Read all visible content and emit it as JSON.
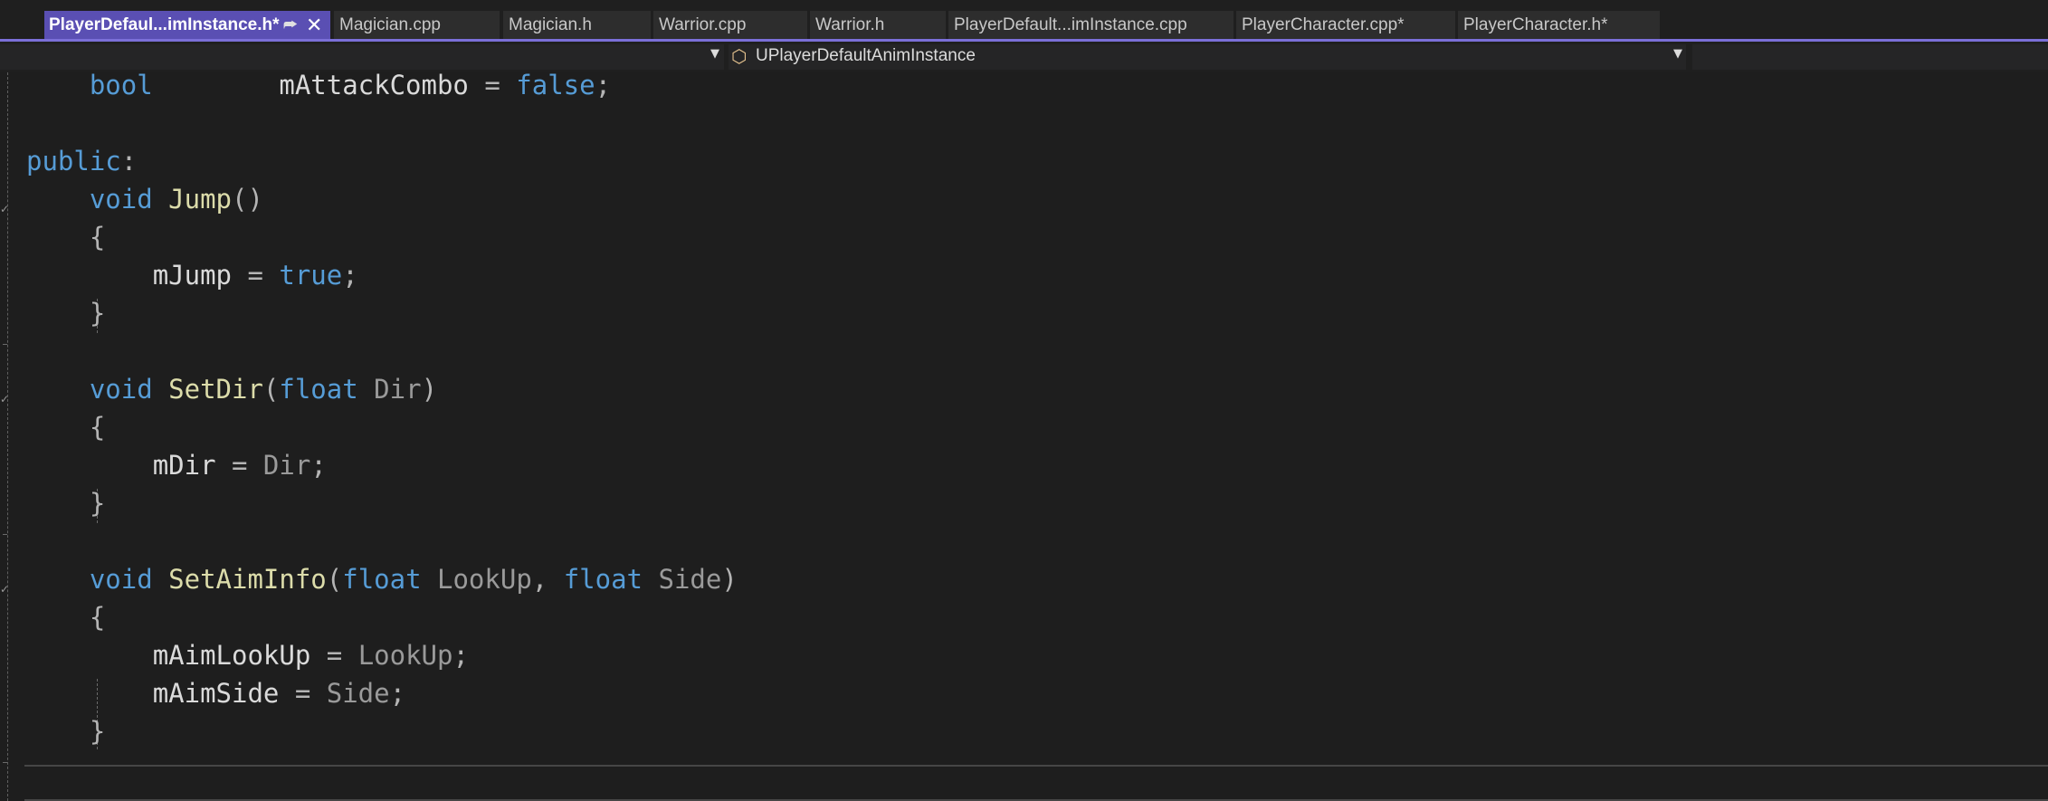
{
  "tabs": [
    {
      "label": "PlayerDefaul...imInstance.h*",
      "active": true,
      "pin_icon": "pin-icon",
      "close_icon": "close-icon"
    },
    {
      "label": "Magician.cpp"
    },
    {
      "label": "Magician.h"
    },
    {
      "label": "Warrior.cpp"
    },
    {
      "label": "Warrior.h"
    },
    {
      "label": "PlayerDefault...imInstance.cpp"
    },
    {
      "label": "PlayerCharacter.cpp*"
    },
    {
      "label": "PlayerCharacter.h*"
    }
  ],
  "navbar": {
    "scope_selector": "",
    "class_selector": "UPlayerDefaultAnimInstance",
    "class_icon": "class-icon",
    "member_selector": ""
  },
  "colors": {
    "active_tab": "#5a4fb3",
    "keyword": "#569cd6",
    "function": "#dcdcaa",
    "parameter": "#9a9a9a",
    "identifier": "#dadada",
    "background": "#1e1e1e"
  },
  "code": {
    "lines": [
      [
        {
          "t": "    "
        },
        {
          "t": "bool",
          "c": "kw"
        },
        {
          "t": "        "
        },
        {
          "t": "mAttackCombo",
          "c": "var"
        },
        {
          "t": " = ",
          "c": "pun"
        },
        {
          "t": "false",
          "c": "kw"
        },
        {
          "t": ";",
          "c": "pun"
        }
      ],
      [],
      [
        {
          "t": "public",
          "c": "kw"
        },
        {
          "t": ":",
          "c": "pun"
        }
      ],
      [
        {
          "t": "    "
        },
        {
          "t": "void",
          "c": "kw"
        },
        {
          "t": " "
        },
        {
          "t": "Jump",
          "c": "fn"
        },
        {
          "t": "()",
          "c": "pun"
        }
      ],
      [
        {
          "t": "    "
        },
        {
          "t": "{",
          "c": "pun"
        }
      ],
      [
        {
          "t": "        "
        },
        {
          "t": "mJump",
          "c": "var"
        },
        {
          "t": " = ",
          "c": "pun"
        },
        {
          "t": "true",
          "c": "kw"
        },
        {
          "t": ";",
          "c": "pun"
        }
      ],
      [
        {
          "t": "    "
        },
        {
          "t": "}",
          "c": "pun"
        }
      ],
      [],
      [
        {
          "t": "    "
        },
        {
          "t": "void",
          "c": "kw"
        },
        {
          "t": " "
        },
        {
          "t": "SetDir",
          "c": "fn"
        },
        {
          "t": "(",
          "c": "pun"
        },
        {
          "t": "float",
          "c": "kw"
        },
        {
          "t": " "
        },
        {
          "t": "Dir",
          "c": "par"
        },
        {
          "t": ")",
          "c": "pun"
        }
      ],
      [
        {
          "t": "    "
        },
        {
          "t": "{",
          "c": "pun"
        }
      ],
      [
        {
          "t": "        "
        },
        {
          "t": "mDir",
          "c": "var"
        },
        {
          "t": " = ",
          "c": "pun"
        },
        {
          "t": "Dir",
          "c": "par"
        },
        {
          "t": ";",
          "c": "pun"
        }
      ],
      [
        {
          "t": "    "
        },
        {
          "t": "}",
          "c": "pun"
        }
      ],
      [],
      [
        {
          "t": "    "
        },
        {
          "t": "void",
          "c": "kw"
        },
        {
          "t": " "
        },
        {
          "t": "SetAimInfo",
          "c": "fn"
        },
        {
          "t": "(",
          "c": "pun"
        },
        {
          "t": "float",
          "c": "kw"
        },
        {
          "t": " "
        },
        {
          "t": "LookUp",
          "c": "par"
        },
        {
          "t": ", ",
          "c": "pun"
        },
        {
          "t": "float",
          "c": "kw"
        },
        {
          "t": " "
        },
        {
          "t": "Side",
          "c": "par"
        },
        {
          "t": ")",
          "c": "pun"
        }
      ],
      [
        {
          "t": "    "
        },
        {
          "t": "{",
          "c": "pun"
        }
      ],
      [
        {
          "t": "        "
        },
        {
          "t": "mAimLookUp",
          "c": "var"
        },
        {
          "t": " = ",
          "c": "pun"
        },
        {
          "t": "LookUp",
          "c": "par"
        },
        {
          "t": ";",
          "c": "pun"
        }
      ],
      [
        {
          "t": "        "
        },
        {
          "t": "mAimSide",
          "c": "var"
        },
        {
          "t": " = ",
          "c": "pun"
        },
        {
          "t": "Side",
          "c": "par"
        },
        {
          "t": ";",
          "c": "pun"
        }
      ],
      [
        {
          "t": "    "
        },
        {
          "t": "}",
          "c": "pun"
        }
      ]
    ]
  }
}
